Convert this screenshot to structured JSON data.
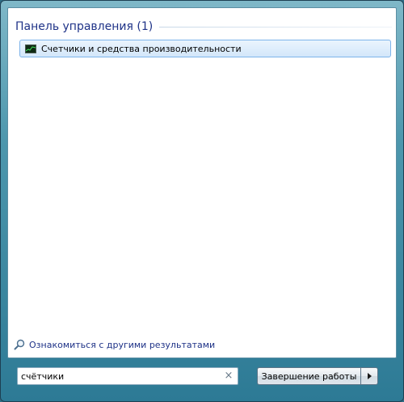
{
  "results": {
    "group_title": "Панель управления (1)",
    "items": [
      {
        "label": "Счетчики и средства производительности",
        "icon": "performance-monitor-icon"
      }
    ]
  },
  "more_results": {
    "label": "Ознакомиться с другими результатами",
    "icon": "magnifier-icon"
  },
  "search": {
    "value": "счётчики",
    "clear_icon": "×"
  },
  "shutdown": {
    "label": "Завершение работы",
    "arrow_icon": "arrow-right-icon"
  },
  "colors": {
    "link": "#1e3287",
    "selection_border": "#7eb4ea",
    "frame": "#4d97ad"
  }
}
